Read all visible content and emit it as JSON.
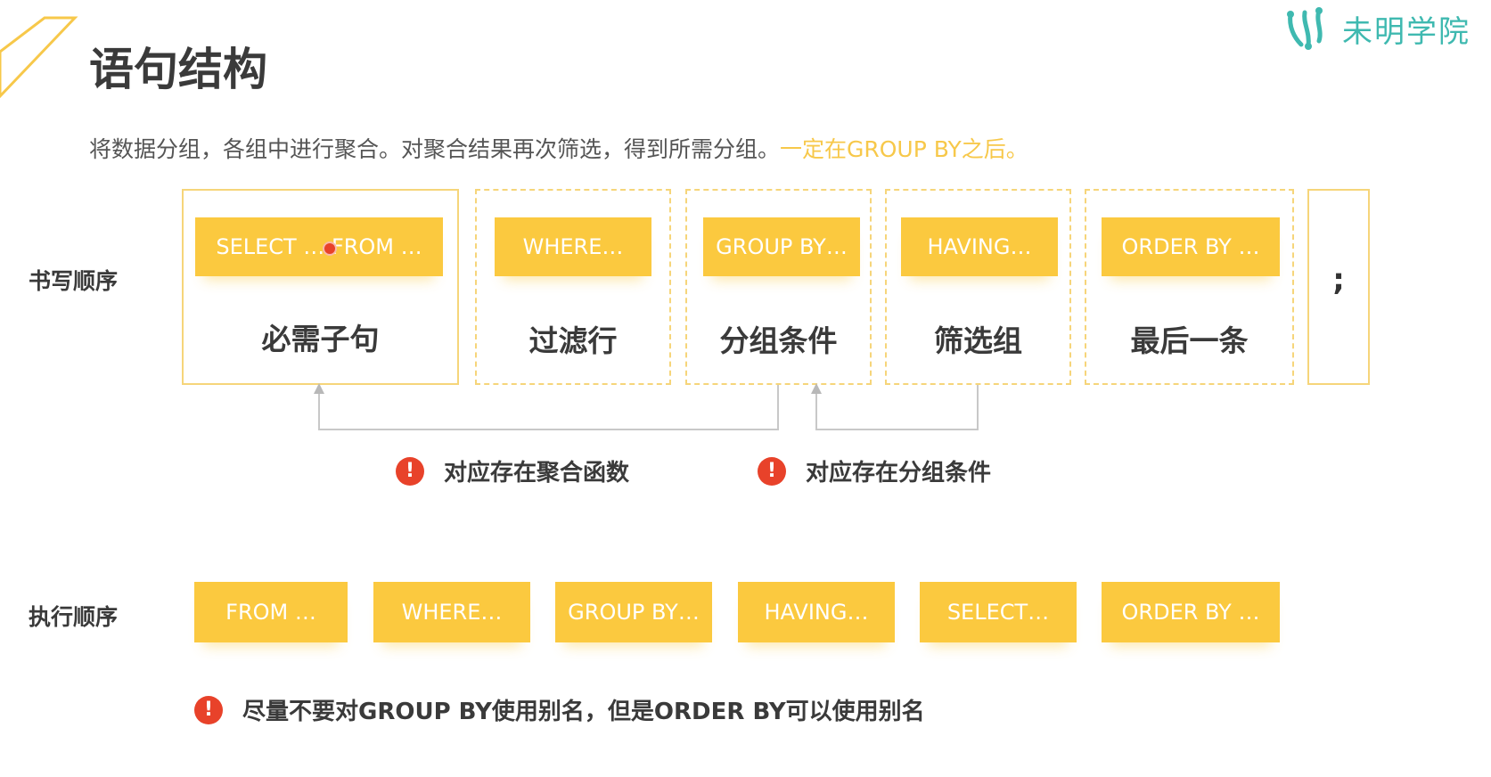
{
  "title": "语句结构",
  "subtitle": {
    "text": "将数据分组，各组中进行聚合。对聚合结果再次筛选，得到所需分组。",
    "highlight": "一定在GROUP BY之后。"
  },
  "logo": {
    "text": "未明学院",
    "icon": "molecule-logo-icon"
  },
  "writing_order": {
    "label": "书写顺序",
    "clauses": [
      {
        "keyword": "SELECT … FROM …",
        "description": "必需子句"
      },
      {
        "keyword": "WHERE…",
        "description": "过滤行"
      },
      {
        "keyword": "GROUP BY…",
        "description": "分组条件"
      },
      {
        "keyword": "HAVING…",
        "description": "筛选组"
      },
      {
        "keyword": "ORDER BY …",
        "description": "最后一条"
      }
    ],
    "terminator": ";"
  },
  "notes": {
    "aggregate": "对应存在聚合函数",
    "group_condition": "对应存在分组条件",
    "alias": "尽量不要对GROUP BY使用别名，但是ORDER BY可以使用别名"
  },
  "execution_order": {
    "label": "执行顺序",
    "steps": [
      "FROM …",
      "WHERE…",
      "GROUP BY…",
      "HAVING…",
      "SELECT…",
      "ORDER BY …"
    ]
  },
  "colors": {
    "accent": "#fbc93f",
    "border": "#f6d57a",
    "warning": "#e8422a",
    "logo": "#3fb9b0",
    "highlight_text": "#f7c84a"
  }
}
